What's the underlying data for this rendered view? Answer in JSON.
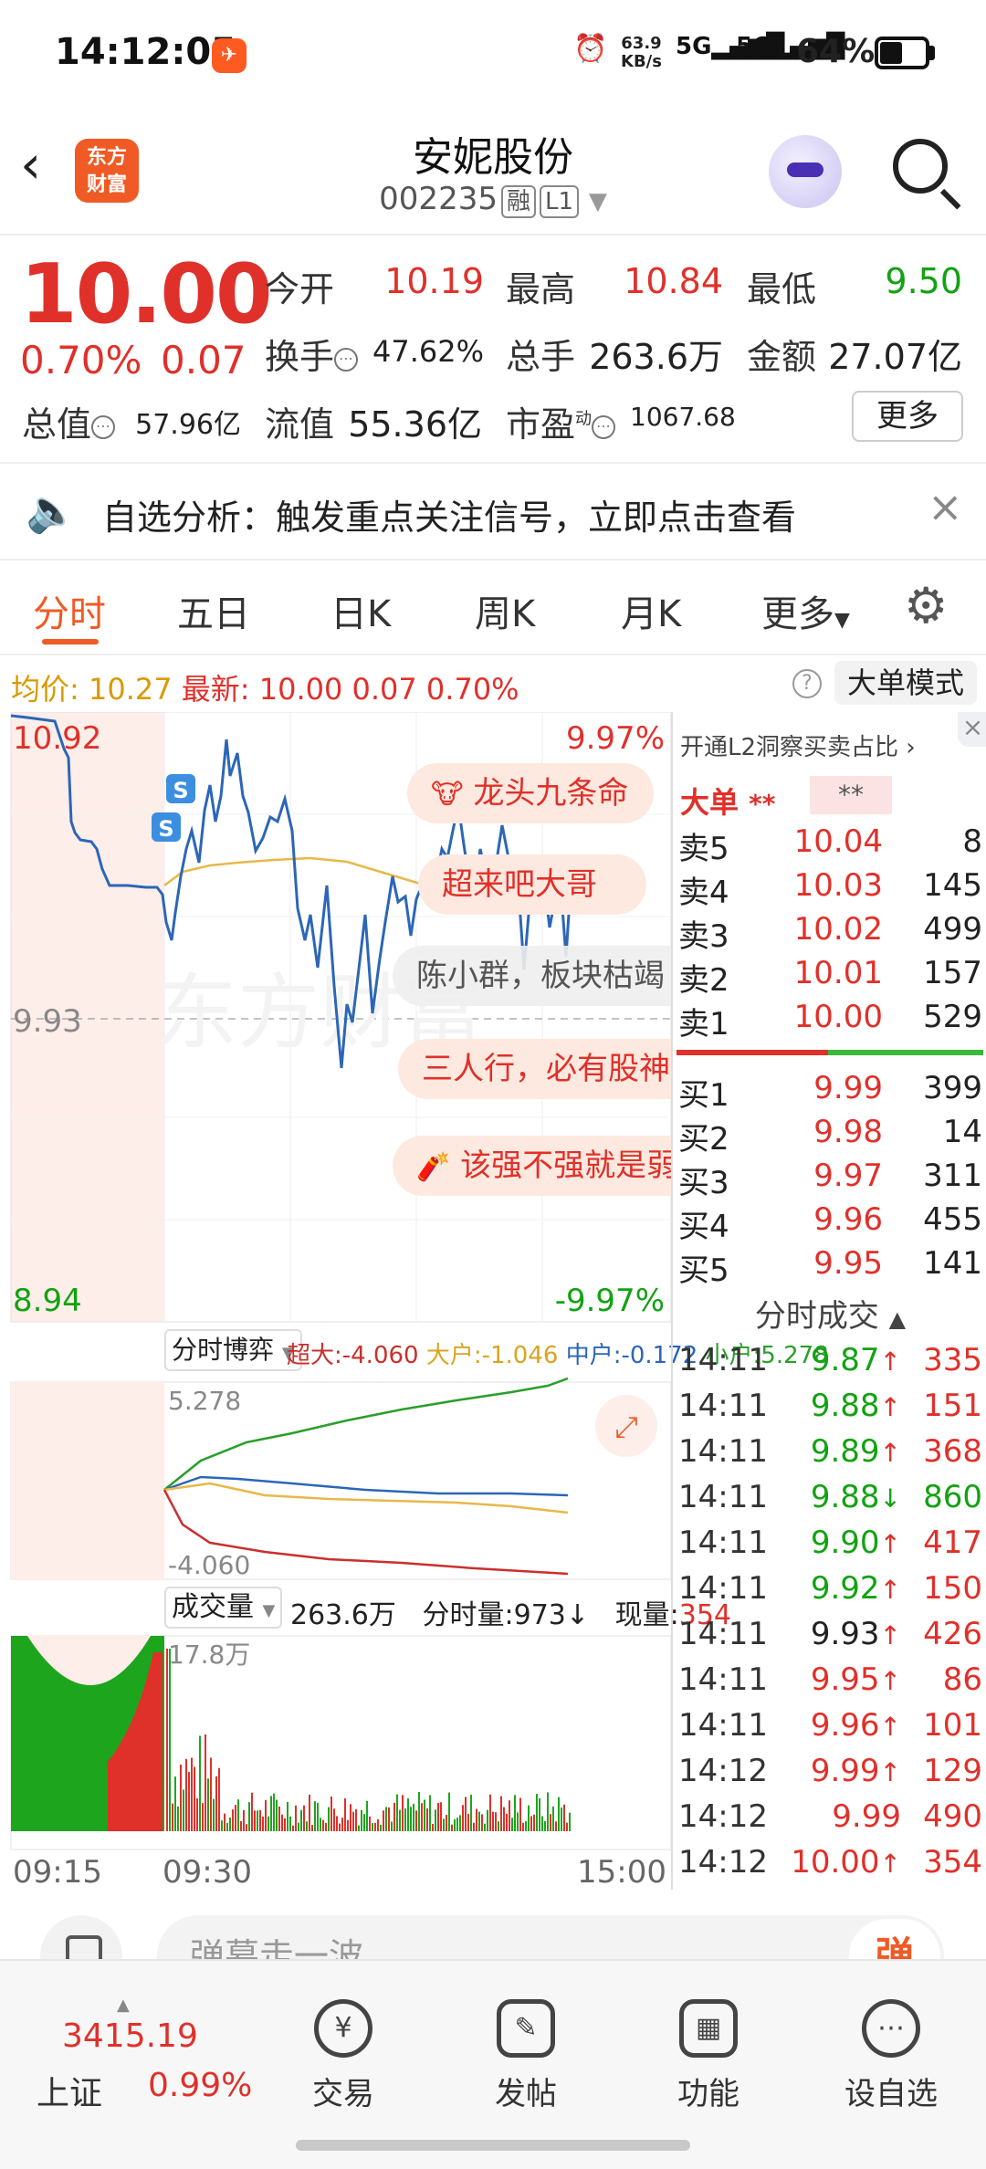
{
  "status": {
    "time": "14:12:05",
    "net_speed": "63.9",
    "net_unit": "KB/s",
    "battery": "64%"
  },
  "header": {
    "title": "安妮股份",
    "code": "002235",
    "tag1": "融",
    "tag2": "L1",
    "logo_line1": "东方",
    "logo_line2": "财富"
  },
  "quote": {
    "price": "10.00",
    "pct": "0.70%",
    "change": "0.07",
    "open_label": "今开",
    "open": "10.19",
    "high_label": "最高",
    "high": "10.84",
    "low_label": "最低",
    "low": "9.50",
    "turnover_label": "换手",
    "turnover": "47.62%",
    "volume_label": "总手",
    "volume": "263.6万",
    "amount_label": "金额",
    "amount": "27.07亿",
    "mktcap_label": "总值",
    "mktcap": "57.96亿",
    "float_label": "流值",
    "float": "55.36亿",
    "pe_label": "市盈",
    "pe_sup": "动",
    "pe": "1067.68",
    "more": "更多"
  },
  "banner": {
    "text": "自选分析：触发重点关注信号，立即点击查看"
  },
  "tabs": [
    "分时",
    "五日",
    "日K",
    "周K",
    "月K",
    "更多"
  ],
  "info": {
    "avg_label": "均价:",
    "avg": "10.27",
    "latest_label": "最新:",
    "latest": "10.00",
    "chg": "0.07",
    "pct": "0.70%",
    "big_order": "大单模式"
  },
  "chart": {
    "top_price": "10.92",
    "top_pct": "9.97%",
    "mid_price": "9.93",
    "bot_price": "8.94",
    "bot_pct": "-9.97%",
    "flow_selector": "分时博弈",
    "flow": {
      "super": "超大:-4.060",
      "big": "大户:-1.046",
      "mid": "中户:-0.172",
      "small": "小户:5.278"
    },
    "flow_max": "5.278",
    "flow_min": "-4.060",
    "vol_selector": "成交量",
    "vol_total": "263.6万",
    "vol_min_label": "分时量:973↓",
    "vol_now_label": "现量:",
    "vol_now": "354",
    "vol_max": "17.8万",
    "t_start": "09:15",
    "t_open": "09:30",
    "t_end": "15:00"
  },
  "danmaku": [
    "龙头九条命",
    "超来吧大哥",
    "陈小群，板块枯竭",
    "三人行，必有股神",
    "该强不强就是弱"
  ],
  "orderbook": {
    "header": "开通L2洞察买卖占比",
    "big_label": "大单",
    "stars1": "**",
    "stars2": "**",
    "asks": [
      {
        "n": "卖5",
        "p": "10.04",
        "v": "8"
      },
      {
        "n": "卖4",
        "p": "10.03",
        "v": "145"
      },
      {
        "n": "卖3",
        "p": "10.02",
        "v": "499"
      },
      {
        "n": "卖2",
        "p": "10.01",
        "v": "157"
      },
      {
        "n": "卖1",
        "p": "10.00",
        "v": "529"
      }
    ],
    "bids": [
      {
        "n": "买1",
        "p": "9.99",
        "v": "399"
      },
      {
        "n": "买2",
        "p": "9.98",
        "v": "14"
      },
      {
        "n": "买3",
        "p": "9.97",
        "v": "311"
      },
      {
        "n": "买4",
        "p": "9.96",
        "v": "455"
      },
      {
        "n": "买5",
        "p": "9.95",
        "v": "141"
      }
    ],
    "ticks_label": "分时成交",
    "ticks": [
      {
        "t": "14:11",
        "p": "9.87",
        "d": "↑",
        "v": "335",
        "pc": "green",
        "vc": "red"
      },
      {
        "t": "14:11",
        "p": "9.88",
        "d": "↑",
        "v": "151",
        "pc": "green",
        "vc": "red"
      },
      {
        "t": "14:11",
        "p": "9.89",
        "d": "↑",
        "v": "368",
        "pc": "green",
        "vc": "red"
      },
      {
        "t": "14:11",
        "p": "9.88",
        "d": "↓",
        "v": "860",
        "pc": "green",
        "vc": "green"
      },
      {
        "t": "14:11",
        "p": "9.90",
        "d": "↑",
        "v": "417",
        "pc": "green",
        "vc": "red"
      },
      {
        "t": "14:11",
        "p": "9.92",
        "d": "↑",
        "v": "150",
        "pc": "green",
        "vc": "red"
      },
      {
        "t": "14:11",
        "p": "9.93",
        "d": "↑",
        "v": "426",
        "pc": "gray",
        "vc": "red"
      },
      {
        "t": "14:11",
        "p": "9.95",
        "d": "↑",
        "v": "86",
        "pc": "red",
        "vc": "red"
      },
      {
        "t": "14:11",
        "p": "9.96",
        "d": "↑",
        "v": "101",
        "pc": "red",
        "vc": "red"
      },
      {
        "t": "14:12",
        "p": "9.99",
        "d": "↑",
        "v": "129",
        "pc": "red",
        "vc": "red"
      },
      {
        "t": "14:12",
        "p": "9.99",
        "d": "",
        "v": "490",
        "pc": "red",
        "vc": "red"
      },
      {
        "t": "14:12",
        "p": "10.00",
        "d": "↑",
        "v": "354",
        "pc": "red",
        "vc": "red"
      }
    ]
  },
  "bottom": {
    "input_placeholder": "弹幕走一波…",
    "dm_btn": "弹",
    "index_value": "3415.19",
    "index_name": "上证",
    "index_pct": "0.99%",
    "nav": [
      {
        "label": "交易",
        "icon": "¥"
      },
      {
        "label": "发帖",
        "icon": "✎"
      },
      {
        "label": "功能",
        "icon": "▦"
      },
      {
        "label": "设自选",
        "icon": "⋯"
      }
    ]
  }
}
